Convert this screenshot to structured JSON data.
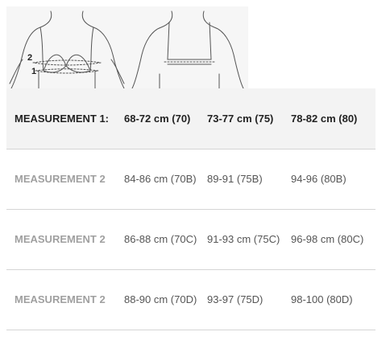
{
  "illustration": {
    "markers": [
      "2",
      "1"
    ]
  },
  "table": {
    "header": {
      "label": "MEASUREMENT 1:",
      "cells": [
        "68-72 cm (70)",
        "73-77 cm (75)",
        "78-82 cm (80)"
      ]
    },
    "rows": [
      {
        "label": "MEASUREMENT 2",
        "cells": [
          "84-86 cm (70B)",
          "89-91 (75B)",
          "94-96 (80B)"
        ]
      },
      {
        "label": "MEASUREMENT 2",
        "cells": [
          "86-88 cm (70C)",
          "91-93 cm (75C)",
          "96-98 cm (80C)"
        ]
      },
      {
        "label": "MEASUREMENT 2",
        "cells": [
          "88-90 cm (70D)",
          "93-97 (75D)",
          "98-100 (80D)"
        ]
      }
    ]
  }
}
